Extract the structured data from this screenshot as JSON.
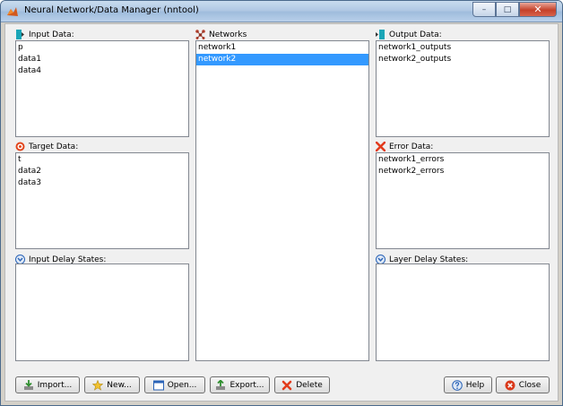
{
  "window": {
    "title": "Neural Network/Data Manager (nntool)",
    "minimize_glyph": "–",
    "maximize_glyph": "□",
    "close_glyph": "✕"
  },
  "panels": {
    "input_data": {
      "label": "Input Data:",
      "items": [
        "p",
        "data1",
        "data4"
      ]
    },
    "target_data": {
      "label": "Target Data:",
      "items": [
        "t",
        "data2",
        "data3"
      ]
    },
    "input_delay": {
      "label": "Input Delay States:",
      "items": []
    },
    "networks": {
      "label": "Networks",
      "items": [
        "network1",
        "network2"
      ],
      "selected_index": 1
    },
    "output_data": {
      "label": "Output Data:",
      "items": [
        "network1_outputs",
        "network2_outputs"
      ]
    },
    "error_data": {
      "label": "Error Data:",
      "items": [
        "network1_errors",
        "network2_errors"
      ]
    },
    "layer_delay": {
      "label": "Layer Delay States:",
      "items": []
    }
  },
  "buttons": {
    "import": "Import...",
    "new": "New...",
    "open": "Open...",
    "export": "Export...",
    "delete": "Delete",
    "help": "Help",
    "close": "Close"
  },
  "colors": {
    "selection": "#3399ff",
    "input_icon": "#1aa6b7",
    "target_icon": "#e2461d",
    "error_icon": "#e23b1b",
    "delay_icon": "#2a63b7",
    "network_icon": "#b7412d"
  },
  "icons": {
    "input_data": "input-data-icon",
    "target_data": "target-icon",
    "delay_states": "chevron-down-circle-icon",
    "networks": "network-icon",
    "output_data": "output-data-icon",
    "error_data": "error-x-icon",
    "import": "import-arrow-icon",
    "new": "star-icon",
    "open": "window-icon",
    "export": "export-arrow-icon",
    "delete": "red-x-icon",
    "help": "help-icon",
    "close": "close-circle-icon"
  }
}
